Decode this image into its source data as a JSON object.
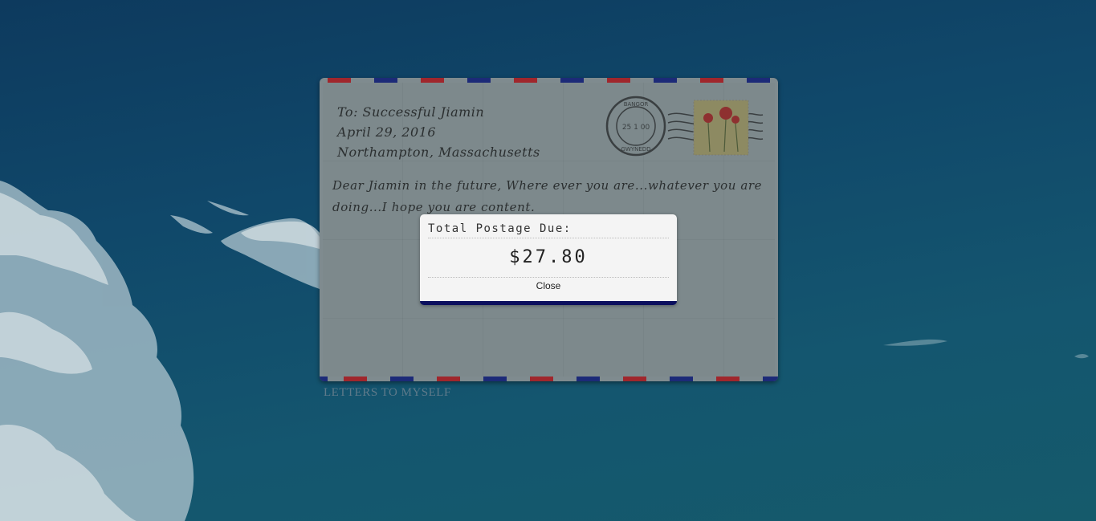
{
  "letter": {
    "to_line": "To: Successful Jiamin",
    "date_line": "April 29, 2016",
    "place_line": "Northampton, Massachusetts",
    "body": "Dear Jiamin in the future, Where ever you are...whatever you are doing...I hope you are content."
  },
  "postmark": {
    "top_text": "BANGOR",
    "center_text": "25 1 00",
    "bottom_text": "GWYNEDD"
  },
  "modal": {
    "title": "Total Postage Due:",
    "amount": "$27.80",
    "close_label": "Close"
  },
  "footer": {
    "logo_text": "LETTERS TO MYSELF"
  },
  "colors": {
    "stripe_red": "#a0262c",
    "stripe_blue": "#1c2a78",
    "modal_accent": "#0b0f5e"
  },
  "icons": {
    "stamp": "poppy-stamp-icon",
    "postmark": "postmark-icon"
  }
}
